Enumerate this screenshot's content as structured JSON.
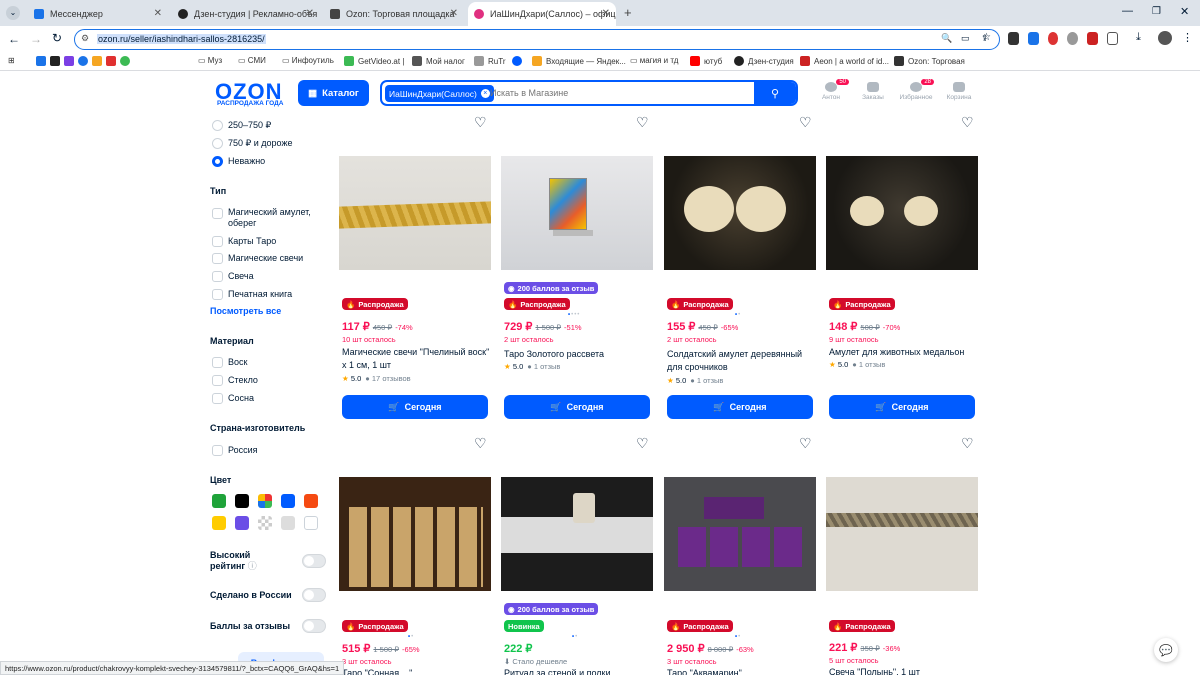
{
  "browser": {
    "tabs": [
      {
        "title": "Мессенджер",
        "color": "#1a73e8"
      },
      {
        "title": "Дзен-студия | Рекламно-объя",
        "color": "#222222"
      },
      {
        "title": "Ozon: Торговая площадка",
        "color": "#444444"
      },
      {
        "title": "ИаШинДхари(Саллос) – офиц",
        "color": "#e03080"
      }
    ],
    "url": "ozon.ru/seller/iashindhari-sallos-2816235/",
    "bookmarks": [
      "Муз",
      "СМИ",
      "Инфоутиль",
      "GetVideo.at |",
      "Мой налог",
      "RuTr",
      "Входящие — Яндек...",
      "магия и тд",
      "ютуб",
      "Дзен-студия",
      "Aeon | a world of id...",
      "Ozon: Торговая"
    ],
    "status_url": "https://www.ozon.ru/product/chakrovyy-komplekt-svechey-3134579811/?_bctx=CAQQ6_GrAQ&hs=1"
  },
  "header": {
    "logo": "OZON",
    "logo_sub": "РАСПРОДАЖА ГОДА",
    "catalog": "Каталог",
    "search_chip": "ИаШинДхари(Саллос)",
    "search_placeholder": "Искать в Магазине",
    "icons": [
      {
        "label": "Антон",
        "badge": "50"
      },
      {
        "label": "Заказы",
        "badge": ""
      },
      {
        "label": "Избранное",
        "badge": "28"
      },
      {
        "label": "Корзина",
        "badge": ""
      }
    ]
  },
  "sidebar": {
    "price_options": [
      "250–750 ₽",
      "750 ₽ и дороже",
      "Неважно"
    ],
    "type_title": "Тип",
    "types": [
      "Магический амулет, оберег",
      "Карты Таро",
      "Магические свечи",
      "Свеча",
      "Печатная книга"
    ],
    "show_all": "Посмотреть все",
    "material_title": "Материал",
    "materials": [
      "Воск",
      "Стекло",
      "Сосна"
    ],
    "country_title": "Страна-изготовитель",
    "countries": [
      "Россия"
    ],
    "color_title": "Цвет",
    "colors": [
      "#1fa33a",
      "#000000",
      "multi",
      "#005bff",
      "#f54a12",
      "#ffcc00",
      "#6b4ee6",
      "pattern",
      "#dddddd",
      "#ffffff"
    ],
    "toggles": [
      "Высокий рейтинг",
      "Сделано в России",
      "Баллы за отзывы"
    ],
    "all_filters": "Все фильтры"
  },
  "cards_row1": [
    {
      "sale": "Распродажа",
      "points": "",
      "price": "117 ₽",
      "old": "450 ₽",
      "disc": "-74%",
      "left": "10 шт осталось",
      "name": "Магические свечи \"Пчелиный воск\" х 1 см, 1 шт",
      "rating": "5.0",
      "reviews": "17 отзывов",
      "buy": "Сегодня"
    },
    {
      "sale": "Распродажа",
      "points": "200 баллов за отзыв",
      "price": "729 ₽",
      "old": "1 500 ₽",
      "disc": "-51%",
      "left": "2 шт осталось",
      "name": "Таро Золотого рассвета",
      "rating": "5.0",
      "reviews": "1 отзыв",
      "buy": "Сегодня"
    },
    {
      "sale": "Распродажа",
      "points": "",
      "price": "155 ₽",
      "old": "450 ₽",
      "disc": "-65%",
      "left": "2 шт осталось",
      "name": "Солдатский амулет деревянный для срочников",
      "rating": "5.0",
      "reviews": "1 отзыв",
      "buy": "Сегодня"
    },
    {
      "sale": "Распродажа",
      "points": "",
      "price": "148 ₽",
      "old": "500 ₽",
      "disc": "-70%",
      "left": "9 шт осталось",
      "name": "Амулет для животных медальон",
      "rating": "5.0",
      "reviews": "1 отзыв",
      "buy": "Сегодня"
    }
  ],
  "cards_row2": [
    {
      "sale": "Распродажа",
      "points": "",
      "price": "515 ₽",
      "old": "1 500 ₽",
      "disc": "-65%",
      "left": "3 шт осталось",
      "name": "Таро \"Сонная ...\""
    },
    {
      "sale": "Новинка",
      "points": "200 баллов за отзыв",
      "price": "222 ₽",
      "old": "",
      "disc": "",
      "left": "Стало дешевле",
      "name": "Ритуал за стеной и полки..."
    },
    {
      "sale": "Распродажа",
      "points": "",
      "price": "2 950 ₽",
      "old": "8 000 ₽",
      "disc": "-63%",
      "left": "3 шт осталось",
      "name": "Таро \"Аквамарин\""
    },
    {
      "sale": "Распродажа",
      "points": "",
      "price": "221 ₽",
      "old": "350 ₽",
      "disc": "-36%",
      "left": "5 шт осталось",
      "name": "Свеча \"Полынь\", 1 шт"
    }
  ]
}
